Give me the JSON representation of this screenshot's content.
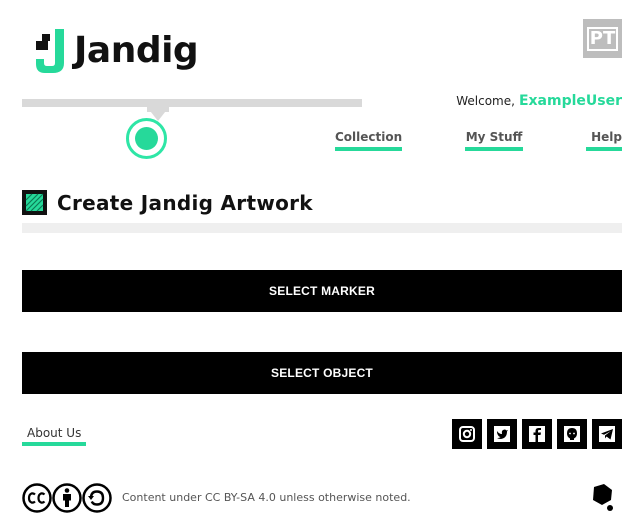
{
  "header": {
    "logo_text": "Jandig",
    "language_button": "PT",
    "welcome_text": "Welcome,",
    "username": "ExampleUser"
  },
  "nav": {
    "items": [
      {
        "label": "Collection"
      },
      {
        "label": "My Stuff"
      },
      {
        "label": "Help"
      }
    ]
  },
  "main": {
    "title": "Create Jandig Artwork",
    "select_marker_label": "SELECT MARKER",
    "select_object_label": "SELECT OBJECT"
  },
  "footer": {
    "about_label": "About Us",
    "license_text": "Content under CC BY-SA 4.0 unless otherwise noted.",
    "socials": [
      "instagram-icon",
      "twitter-icon",
      "facebook-icon",
      "github-icon",
      "telegram-icon"
    ]
  },
  "colors": {
    "accent": "#26d99a",
    "button_bg": "#000000",
    "track": "#d9d9d9"
  }
}
